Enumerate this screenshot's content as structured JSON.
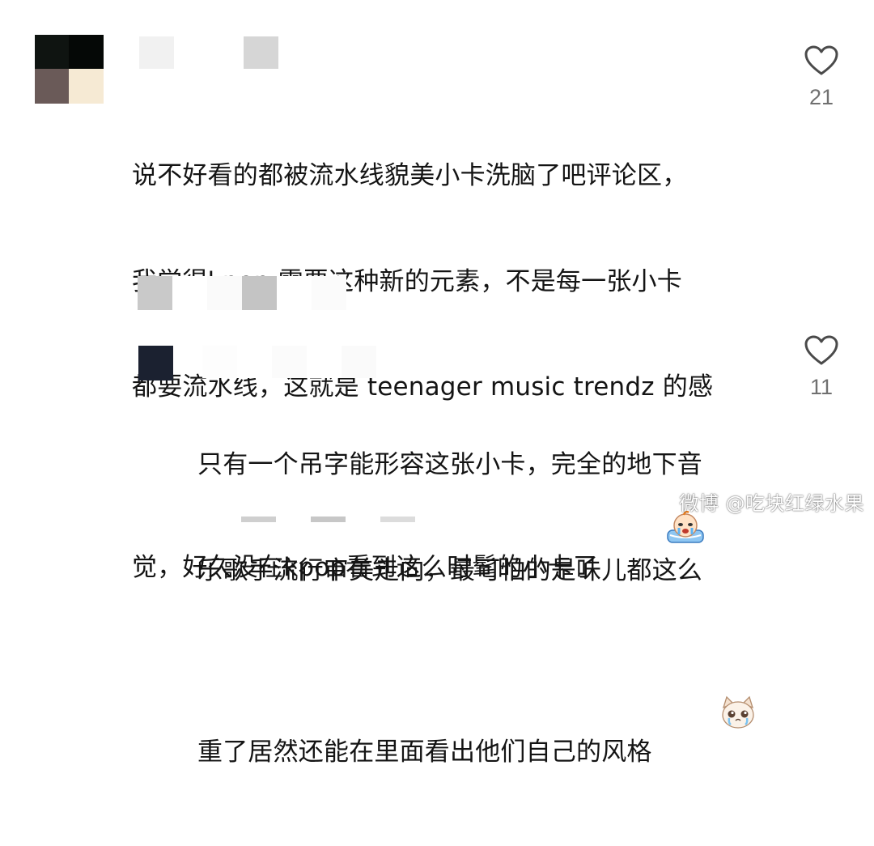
{
  "comments": [
    {
      "text_lines": [
        "说不好看的都被流水线貌美小卡洗脑了吧评论区，",
        "我觉得kpop 需要这种新的元素，不是每一张小卡",
        "都要流水线，这就是 teenager music trendz 的感",
        "觉，好久没在kpop看到这么时髦的小卡了"
      ],
      "trailing_emoji": "crying-face-sticker-icon",
      "likes": "21"
    },
    {
      "text_lines": [
        "只有一个吊字能形容这张小卡，完全的地下音",
        "乐歌手流行审美走向，最可怕的是味儿都这么",
        "重了居然还能在里面看出他们自己的风格"
      ],
      "trailing_emoji": "crying-cat-sticker-icon",
      "likes": "11"
    }
  ],
  "icons": {
    "like": "heart-outline-icon"
  },
  "watermark": "微博 @吃块红绿水果",
  "colors": {
    "text": "#141414",
    "like_count": "#707070",
    "heart_stroke": "#4a4a4a"
  }
}
